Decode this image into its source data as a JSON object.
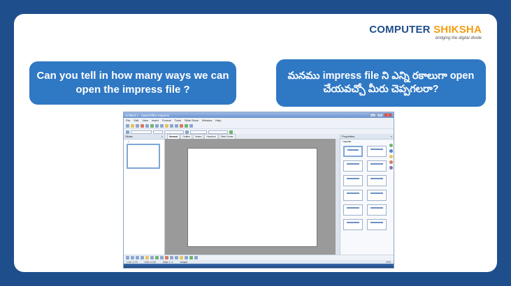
{
  "logo": {
    "text_main": "COMPUTER ",
    "text_accent": "SHIKSHA",
    "tagline": "bridging the digital divide"
  },
  "questions": {
    "english": "Can you tell in how many ways we can open the impress file ?",
    "telugu": "మనము impress file ని ఎన్ని రకాలుగా open చేయవచ్చో మీరు చెప్పగలరా?"
  },
  "screenshot": {
    "window_title": "Untitled 1 - OpenOffice Impress",
    "menu": [
      "File",
      "Edit",
      "View",
      "Insert",
      "Format",
      "Tools",
      "Slide Show",
      "Window",
      "Help"
    ],
    "slides_pane_title": "Slides",
    "slide_number": "1",
    "view_tabs": [
      "Normal",
      "Outline",
      "Notes",
      "Handout",
      "Slide Sorter"
    ],
    "properties_title": "Properties",
    "layouts_label": "Layouts",
    "status": {
      "position": "1.94 / 2.73",
      "size": "0.00 x 0.00",
      "slide": "Slide 1 / 1",
      "master": "Default",
      "zoom": "37%"
    }
  },
  "colors": {
    "background": "#1f4e8c",
    "bubble": "#2f78c4",
    "logo_accent": "#f39c12"
  }
}
